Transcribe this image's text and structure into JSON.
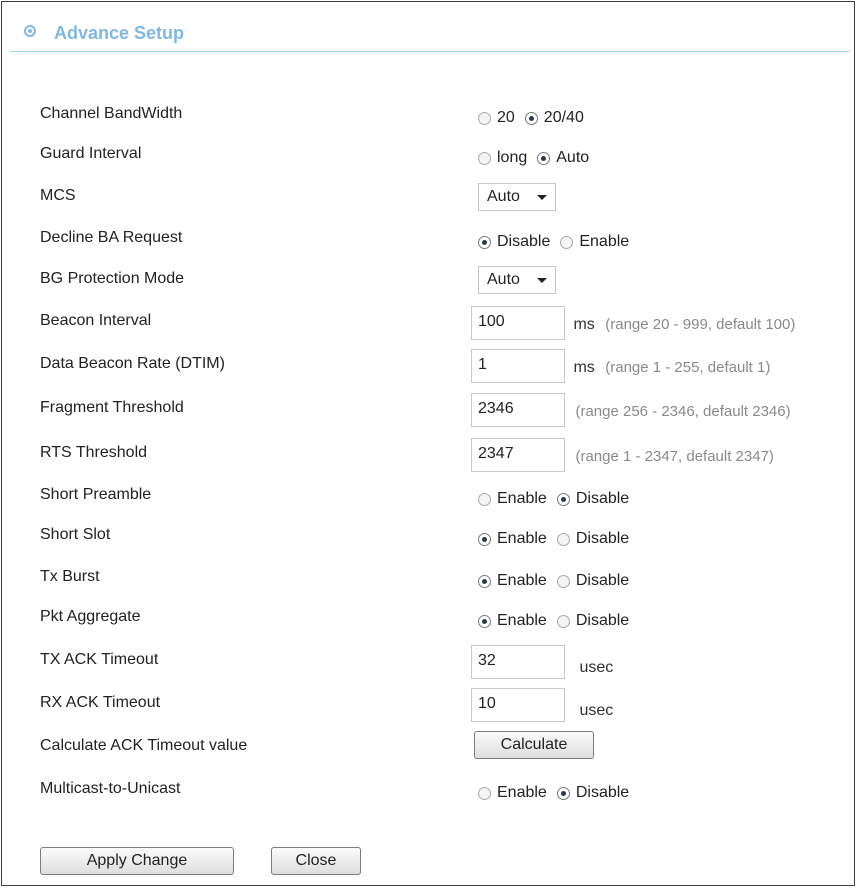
{
  "header": {
    "title": "Advance Setup",
    "icon": "target-icon"
  },
  "settings": {
    "channel_bandwidth": {
      "label": "Channel BandWidth",
      "options": [
        "20",
        "20/40"
      ],
      "selected": "20/40"
    },
    "guard_interval": {
      "label": "Guard Interval",
      "options": [
        "long",
        "Auto"
      ],
      "selected": "Auto"
    },
    "mcs": {
      "label": "MCS",
      "value": "Auto"
    },
    "decline_ba_request": {
      "label": "Decline BA Request",
      "options": [
        "Disable",
        "Enable"
      ],
      "selected": "Disable"
    },
    "bg_protection_mode": {
      "label": "BG Protection Mode",
      "value": "Auto"
    },
    "beacon_interval": {
      "label": "Beacon Interval",
      "value": "100",
      "unit": "ms",
      "hint": "(range 20 - 999, default 100)"
    },
    "data_beacon_rate": {
      "label": "Data Beacon Rate (DTIM)",
      "value": "1",
      "unit": "ms",
      "hint": "(range 1 - 255, default 1)"
    },
    "fragment_threshold": {
      "label": "Fragment Threshold",
      "value": "2346",
      "hint": "(range 256 - 2346, default 2346)"
    },
    "rts_threshold": {
      "label": "RTS Threshold",
      "value": "2347",
      "hint": "(range 1 - 2347, default 2347)"
    },
    "short_preamble": {
      "label": "Short Preamble",
      "options": [
        "Enable",
        "Disable"
      ],
      "selected": "Disable"
    },
    "short_slot": {
      "label": "Short Slot",
      "options": [
        "Enable",
        "Disable"
      ],
      "selected": "Enable"
    },
    "tx_burst": {
      "label": "Tx Burst",
      "options": [
        "Enable",
        "Disable"
      ],
      "selected": "Enable"
    },
    "pkt_aggregate": {
      "label": "Pkt Aggregate",
      "options": [
        "Enable",
        "Disable"
      ],
      "selected": "Enable"
    },
    "tx_ack_timeout": {
      "label": "TX ACK Timeout",
      "value": "32",
      "unit": "usec"
    },
    "rx_ack_timeout": {
      "label": "RX ACK Timeout",
      "value": "10",
      "unit": "usec"
    },
    "calculate_ack": {
      "label": "Calculate ACK Timeout value",
      "button": "Calculate"
    },
    "multicast_to_unicast": {
      "label": "Multicast-to-Unicast",
      "options": [
        "Enable",
        "Disable"
      ],
      "selected": "Disable"
    }
  },
  "footer": {
    "apply_label": "Apply Change",
    "close_label": "Close"
  }
}
